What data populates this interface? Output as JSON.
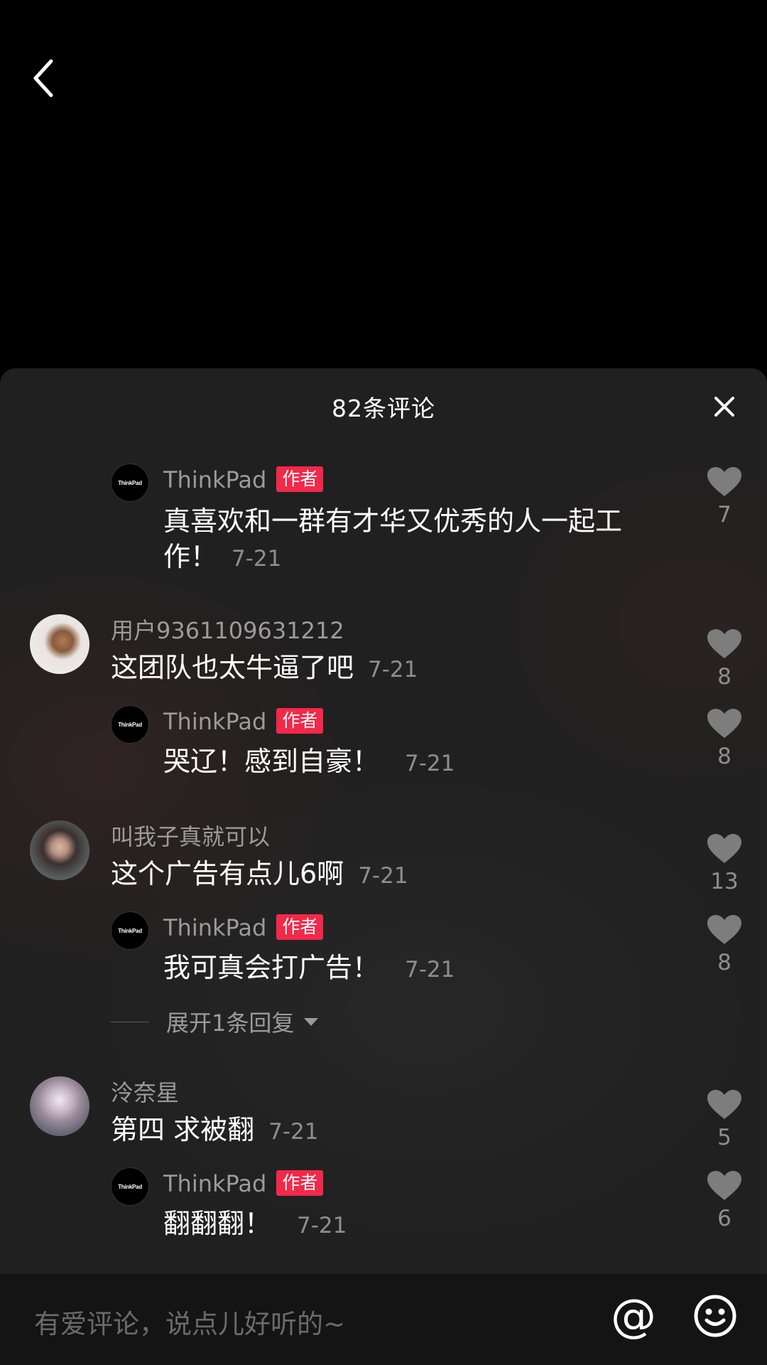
{
  "panel": {
    "title": "82条评论"
  },
  "badge_label": "作者",
  "comments": [
    {
      "username": "ThinkPad",
      "text": "真喜欢和一群有才华又优秀的人一起工",
      "text_line2": "作！",
      "time": "7-21",
      "likes": "7"
    },
    {
      "username": "用户9361109631212",
      "text": "这团队也太牛逼了吧",
      "time": "7-21",
      "likes": "8"
    },
    {
      "username": "ThinkPad",
      "text": "哭辽！感到自豪！",
      "time": "7-21",
      "likes": "8"
    },
    {
      "username": "叫我子真就可以",
      "text": "这个广告有点儿6啊",
      "time": "7-21",
      "likes": "13"
    },
    {
      "username": "ThinkPad",
      "text": "我可真会打广告！",
      "time": "7-21",
      "likes": "8"
    },
    {
      "username": "泠奈星",
      "text": "第四 求被翻",
      "time": "7-21",
      "likes": "5"
    },
    {
      "username": "ThinkPad",
      "text": "翻翻翻！",
      "time": "7-21",
      "likes": "6"
    }
  ],
  "expand_replies": "展开1条回复",
  "input": {
    "placeholder": "有爱评论，说点儿好听的~",
    "at_symbol": "@"
  },
  "brand_avatar_text": "ThinkPad",
  "icons": {
    "back": "chevron-left-icon",
    "close": "close-icon",
    "like": "heart-icon",
    "emoji": "smiley-icon"
  }
}
